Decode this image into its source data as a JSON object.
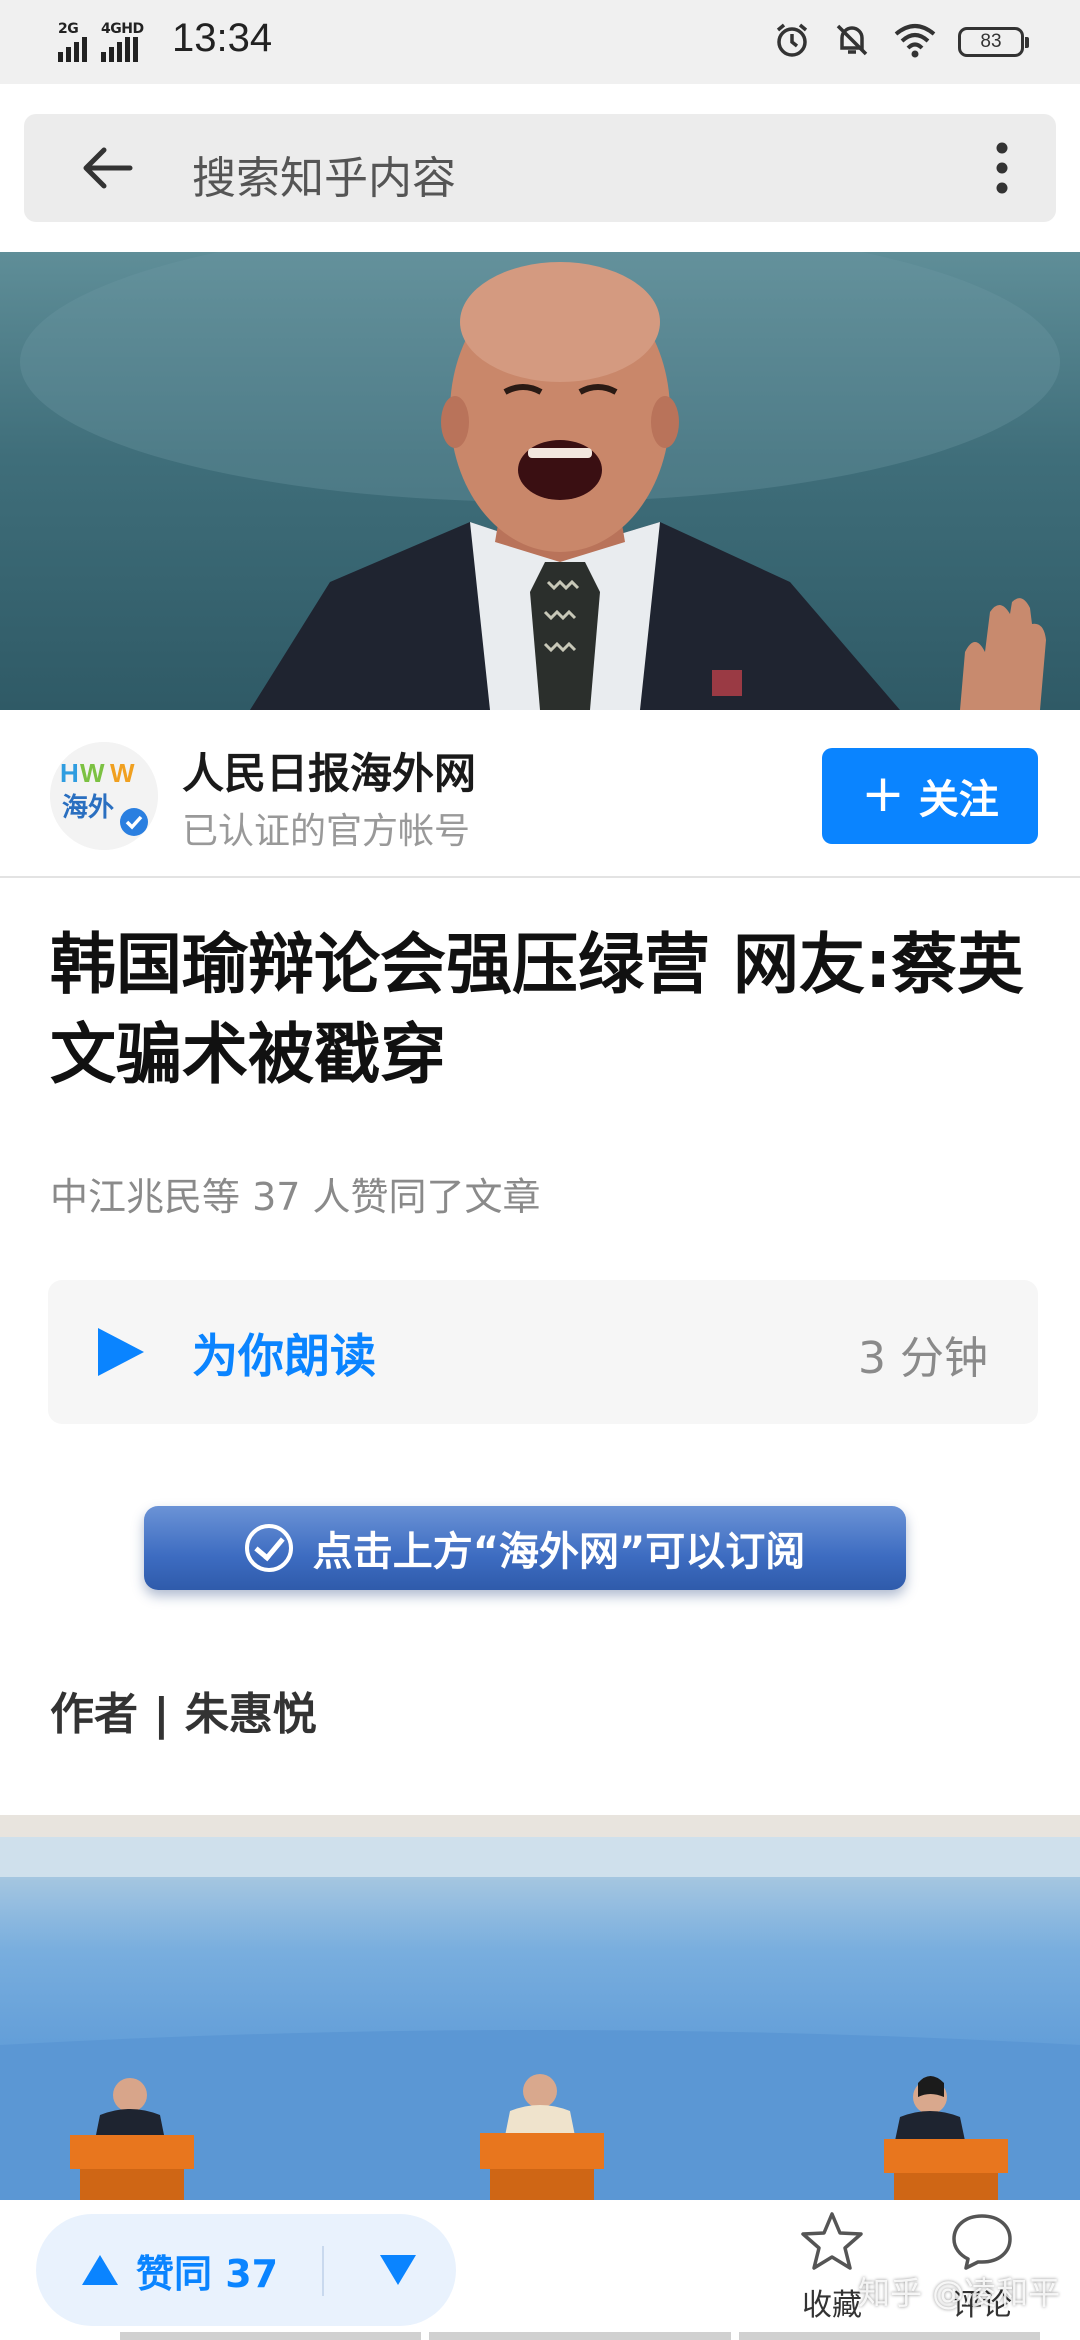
{
  "status_bar": {
    "time": "13:34",
    "net1": "2G",
    "net2": "4GHD",
    "battery": "83"
  },
  "search": {
    "placeholder": "搜索知乎内容"
  },
  "author": {
    "name": "人民日报海外网",
    "subtitle": "已认证的官方帐号",
    "follow_label": "关注",
    "avatar_text": "海外"
  },
  "article": {
    "title": "韩国瑜辩论会强压绿营 网友:蔡英文骗术被戳穿",
    "likers_text": "中江兆民等 37 人赞同了文章",
    "read_aloud_label": "为你朗读",
    "read_time": "3 分钟",
    "subscribe_banner": "点击上方“海外网”可以订阅",
    "byline": "作者 | 朱惠悦"
  },
  "bottom_bar": {
    "upvote_label": "赞同 37",
    "collect_label": "收藏",
    "comment_label": "评论"
  },
  "watermark": "知乎 @凌和平",
  "colors": {
    "accent": "#0a84ff",
    "vote_bg": "#e9f2fd"
  }
}
